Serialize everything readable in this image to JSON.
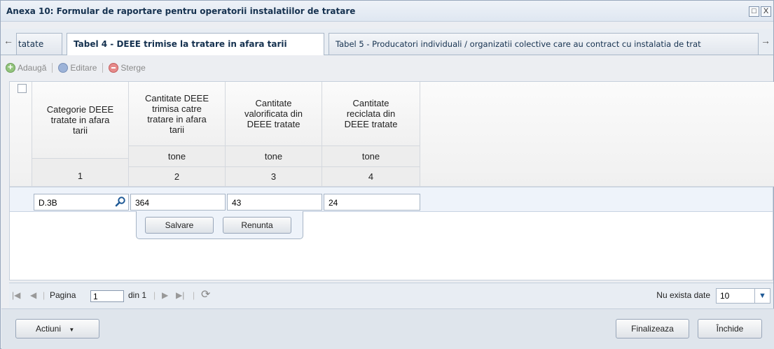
{
  "window": {
    "title": "Anexa 10: Formular de raportare pentru operatorii instalatiilor de tratare",
    "restore_glyph": "□",
    "close_glyph": "X"
  },
  "tabs": [
    {
      "label": "tatate",
      "active": false
    },
    {
      "label": "Tabel 4 - DEEE trimise la tratare in afara tarii",
      "active": true
    },
    {
      "label": "Tabel 5 - Producatori individuali / organizatii colective care au contract cu instalatia de trat",
      "active": false
    }
  ],
  "toolbar": {
    "add_label": "Adaugă",
    "edit_label": "Editare",
    "delete_label": "Sterge"
  },
  "grid": {
    "columns": [
      {
        "header": "Categorie DEEE tratate in afara tarii",
        "unit": "",
        "number": "1"
      },
      {
        "header": "Cantitate DEEE trimisa catre tratare in afara tarii",
        "unit": "tone",
        "number": "2"
      },
      {
        "header": "Cantitate valorificata din DEEE tratate",
        "unit": "tone",
        "number": "3"
      },
      {
        "header": "Cantitate reciclata din DEEE tratate",
        "unit": "tone",
        "number": "4"
      }
    ],
    "editor": {
      "categorie": "D.3B",
      "cantitate_trimisa": "364",
      "cantitate_valorificata": "43",
      "cantitate_reciclata": "24"
    },
    "save_label": "Salvare",
    "cancel_label": "Renunta"
  },
  "pager": {
    "page_label": "Pagina",
    "page_value": "1",
    "of_label": "din 1",
    "status": "Nu exista date",
    "page_size": "10"
  },
  "footer": {
    "actions_label": "Actiuni",
    "finish_label": "Finalizeaza",
    "close_label": "Închide"
  }
}
